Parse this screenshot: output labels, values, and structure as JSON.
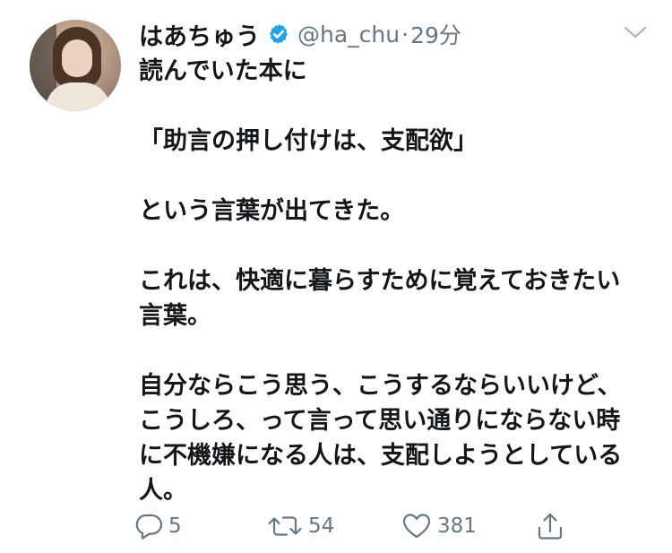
{
  "tweet": {
    "display_name": "はあちゅう",
    "handle": "@ha_chu",
    "separator": "·",
    "time": "29分",
    "verified_icon": "verified-badge-icon",
    "lines": [
      "読んでいた本に",
      "",
      "「助言の押し付けは、支配欲」",
      "",
      "という言葉が出てきた。",
      "",
      "これは、快適に暮らすために覚えておきたい",
      "言葉。",
      "",
      "自分ならこう思う、こうするならいいけど、",
      "こうしろ、って言って思い通りにならない時",
      "に不機嫌になる人は、支配しようとしている",
      "人。"
    ]
  },
  "actions": {
    "reply_count": "5",
    "retweet_count": "54",
    "like_count": "381",
    "icons": [
      "reply-icon",
      "retweet-icon",
      "like-icon",
      "share-icon"
    ]
  },
  "colors": {
    "text": "#14171a",
    "secondary": "#657786",
    "verified": "#1da1f2"
  }
}
